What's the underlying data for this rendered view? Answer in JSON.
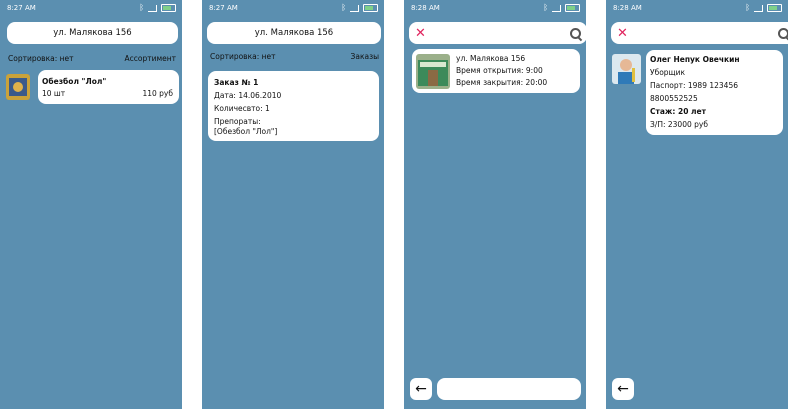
{
  "screens": [
    {
      "time": "8:27 AM",
      "title": "ул. Малякова 156",
      "sort_label": "Сортировка: нет",
      "right_label": "Ассортимент",
      "item": {
        "name": "Обезбол \"Лол\"",
        "qty": "10 шт",
        "price": "110 руб"
      }
    },
    {
      "time": "8:27 AM",
      "title": "ул. Малякова 156",
      "sort_label": "Сортировка: нет",
      "right_label": "Заказы",
      "order": {
        "title": "Заказ № 1",
        "date": "Дата: 14.06.2010",
        "count": "Количесвто: 1",
        "drugs_label": "Препораты:",
        "drugs": "[Обезбол \"Лол\"]"
      }
    },
    {
      "time": "8:28 AM",
      "pharmacy": {
        "address": "ул. Малякова 156",
        "open": "Время открытия: 9:00",
        "close": "Время закрытия: 20:00"
      }
    },
    {
      "time": "8:28 AM",
      "employee": {
        "name": "Олег Непук Овечкин",
        "role": "Уборщик",
        "passport": "Паспорт: 1989 123456",
        "phone": "8800552525",
        "experience": "Стаж: 20 лет",
        "salary": "З/П: 23000 руб"
      }
    }
  ],
  "colors": {
    "background": "#5b8fb0",
    "card": "#ffffff",
    "close_icon": "#e0245e"
  },
  "icons": [
    "bluetooth-icon",
    "signal-icon",
    "battery-icon",
    "close-icon",
    "search-icon",
    "back-arrow-icon"
  ]
}
